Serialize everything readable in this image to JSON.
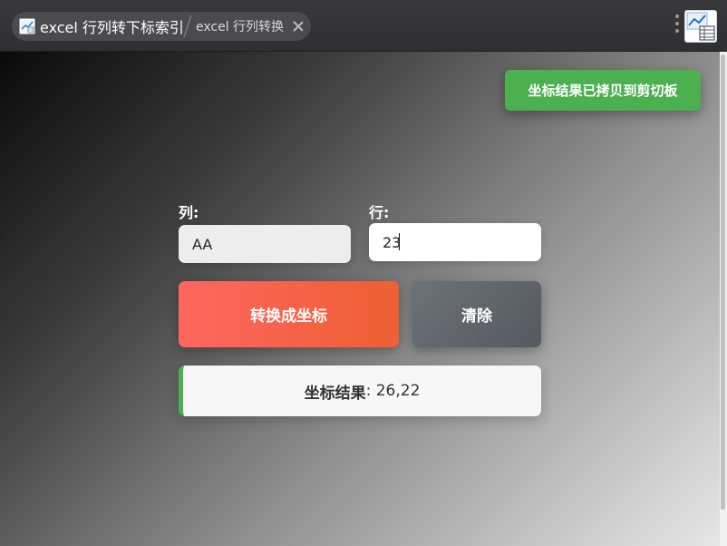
{
  "tabs": {
    "active_title": "excel 行列转下标索引",
    "second_title": "excel 行列转换"
  },
  "icons": {
    "app": "spreadsheet-chart-icon",
    "close": "close-icon",
    "menu": "more-vert-icon",
    "extension": "chart-table-icon"
  },
  "toast": {
    "message": "坐标结果已拷贝到剪切板"
  },
  "form": {
    "col_label": "列:",
    "col_value": "AA",
    "row_label": "行:",
    "row_value": "23"
  },
  "buttons": {
    "convert": "转换成坐标",
    "clear": "清除"
  },
  "result": {
    "label": "坐标结果",
    "separator": ": ",
    "value": "26,22"
  },
  "colors": {
    "toast_bg": "#4caf50",
    "convert_start": "#fe6661",
    "convert_end": "#ee5f31",
    "clear_bg": "#5f6369",
    "result_accent": "#4caf50"
  }
}
